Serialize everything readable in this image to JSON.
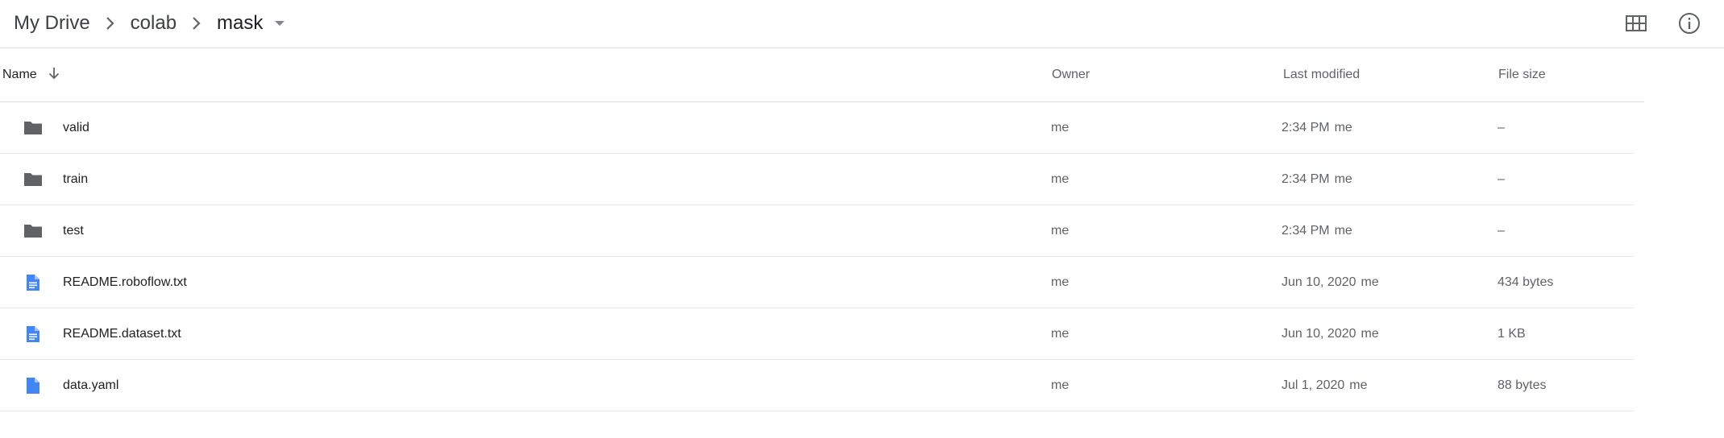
{
  "breadcrumb": {
    "items": [
      "My Drive",
      "colab",
      "mask"
    ]
  },
  "toolbar": {
    "grid_view_icon": "grid-view-icon",
    "info_icon": "info-icon"
  },
  "columns": {
    "name": "Name",
    "owner": "Owner",
    "last_modified": "Last modified",
    "file_size": "File size"
  },
  "rows": [
    {
      "type": "folder",
      "icon": "folder-icon",
      "name": "valid",
      "owner": "me",
      "modified": "2:34 PM",
      "modified_by": "me",
      "size": "–"
    },
    {
      "type": "folder",
      "icon": "folder-icon",
      "name": "train",
      "owner": "me",
      "modified": "2:34 PM",
      "modified_by": "me",
      "size": "–"
    },
    {
      "type": "folder",
      "icon": "folder-icon",
      "name": "test",
      "owner": "me",
      "modified": "2:34 PM",
      "modified_by": "me",
      "size": "–"
    },
    {
      "type": "doc",
      "icon": "document-icon",
      "name": "README.roboflow.txt",
      "owner": "me",
      "modified": "Jun 10, 2020",
      "modified_by": "me",
      "size": "434 bytes"
    },
    {
      "type": "doc",
      "icon": "document-icon",
      "name": "README.dataset.txt",
      "owner": "me",
      "modified": "Jun 10, 2020",
      "modified_by": "me",
      "size": "1 KB"
    },
    {
      "type": "file",
      "icon": "file-icon",
      "name": "data.yaml",
      "owner": "me",
      "modified": "Jul 1, 2020",
      "modified_by": "me",
      "size": "88 bytes"
    }
  ],
  "colors": {
    "folder": "#5f6368",
    "document": "#4285f4",
    "divider": "#dadce0"
  }
}
